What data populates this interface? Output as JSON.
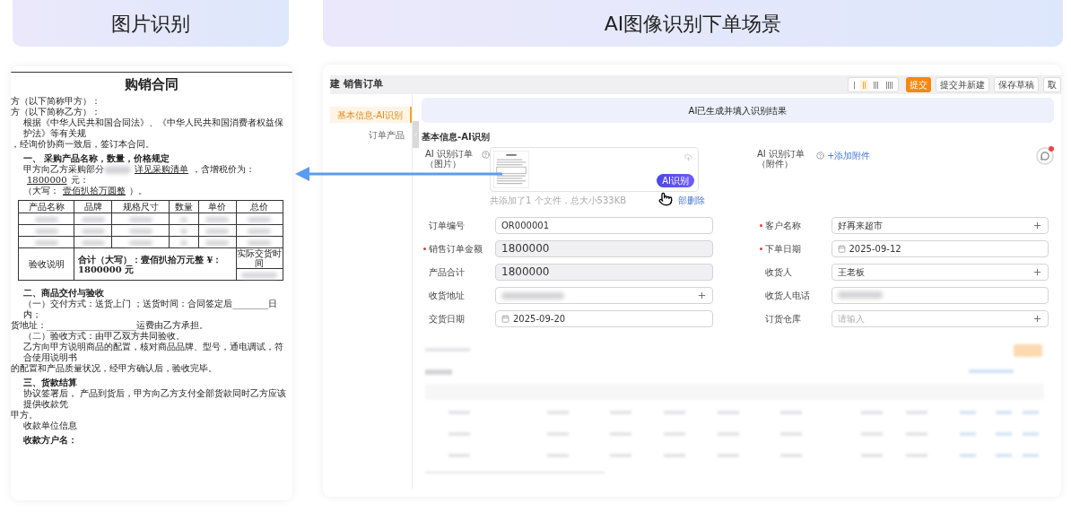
{
  "headers": [
    {
      "title": "图片识别"
    },
    {
      "title": "AI图像识别下单场景"
    }
  ],
  "document": {
    "title": "购销合同",
    "blocks": [
      {
        "kind": "line",
        "text": "方（以下简称甲方）："
      },
      {
        "kind": "line",
        "text": "方（以下简称乙方）："
      },
      {
        "kind": "para",
        "text": "根据《中华人民共和国合同法》、《中华人民共和国消费者权益保护法》等有关规"
      },
      {
        "kind": "line",
        "text": "，经询价协商一致后，签订本合同。"
      },
      {
        "kind": "heading",
        "text": "一、  采购产品名称，数量，价格规定"
      },
      {
        "kind": "fill",
        "parts": [
          {
            "kind": "plain",
            "text": "甲方向乙方采购部分"
          },
          {
            "kind": "masked"
          },
          {
            "kind": "underlined",
            "text": "详见采购清单"
          },
          {
            "kind": "plain",
            "text": "，含增税价为："
          },
          {
            "kind": "underlined",
            "text": "1800000"
          },
          {
            "kind": "plain",
            "text": "元："
          }
        ]
      },
      {
        "kind": "fill",
        "parts": [
          {
            "kind": "plain",
            "text": "（大写："
          },
          {
            "kind": "underlined",
            "text": "壹佰扒拾万圆整"
          },
          {
            "kind": "plain",
            "text": "）。"
          }
        ]
      },
      {
        "kind": "table",
        "columns": [
          "产品名称",
          "品牌",
          "规格尺寸",
          "数量",
          "单价",
          "总价"
        ],
        "footer_label": "验收说明",
        "footer_total": "合计（大写）：壹佰扒拾万元整    ¥：1800000 元",
        "footer_time": "实际交货时间"
      },
      {
        "kind": "heading",
        "text": "二、商品交付与验收"
      },
      {
        "kind": "para",
        "text": "（一）交付方式：送货上门 ；送货时间：合同签定后________日内；"
      },
      {
        "kind": "line",
        "text": "货地址：____________________运费由乙方承担。"
      },
      {
        "kind": "para",
        "text": "（二）验收方式：由甲乙双方共同验收。"
      },
      {
        "kind": "para",
        "text": "乙方向甲方说明商品的配置，核对商品品牌、型号，通电调试，符合使用说明书"
      },
      {
        "kind": "line",
        "text": "的配置和产品质量状况，经甲方确认后，验收完毕。"
      },
      {
        "kind": "heading",
        "text": "三、货款结算"
      },
      {
        "kind": "para",
        "text": "协议签署后， 产品到货后，甲方向乙方支付全部货款同时乙方应该提供收款凭"
      },
      {
        "kind": "line",
        "text": "甲方。"
      },
      {
        "kind": "para",
        "text": "收款单位信息"
      },
      {
        "kind": "heading",
        "text": "收款方户名："
      }
    ]
  },
  "app": {
    "title": "建 销售订单",
    "density": [
      {
        "selected": false
      },
      {
        "selected": true
      },
      {
        "selected": false
      },
      {
        "selected": false
      }
    ],
    "buttons": [
      {
        "label": "提交",
        "primary": true
      },
      {
        "label": "提交并新建",
        "primary": false
      },
      {
        "label": "保存草稿",
        "primary": false
      },
      {
        "label": "取",
        "primary": false
      }
    ],
    "nav": [
      {
        "label": "基本信息-AI识别",
        "selected": true
      },
      {
        "label": "订单产品",
        "selected": false
      }
    ],
    "banner": "AI已生成并填入识别结果",
    "section": "基本信息-AI识别",
    "image_upload": {
      "label": "AI 识别订单（图片）",
      "button": "AI识别",
      "summary": "共添加了1 个文件，总大小533KB",
      "delete": "部删除"
    },
    "attachment": {
      "label": "AI 识别订单（附件）",
      "link": "+添加附件"
    },
    "fields_left": [
      {
        "label": "订单编号",
        "required": false,
        "kind": "input",
        "value": "OR000001"
      },
      {
        "label": "销售订单金额",
        "required": true,
        "kind": "readonly",
        "value": "1800000"
      },
      {
        "label": "产品合计",
        "required": false,
        "kind": "readonly",
        "value": "1800000"
      },
      {
        "label": "收货地址",
        "required": false,
        "kind": "masked-picker"
      },
      {
        "label": "交货日期",
        "required": false,
        "kind": "date",
        "value": "2025-09-20"
      }
    ],
    "fields_right": [
      {
        "label": "客户名称",
        "required": true,
        "kind": "picker",
        "value": "好再来超市"
      },
      {
        "label": "下单日期",
        "required": true,
        "kind": "date",
        "value": "2025-09-12"
      },
      {
        "label": "收货人",
        "required": false,
        "kind": "picker",
        "value": "王老板"
      },
      {
        "label": "收货人电话",
        "required": false,
        "kind": "masked"
      },
      {
        "label": "订货仓库",
        "required": false,
        "kind": "picker",
        "placeholder": "请输入"
      }
    ]
  }
}
